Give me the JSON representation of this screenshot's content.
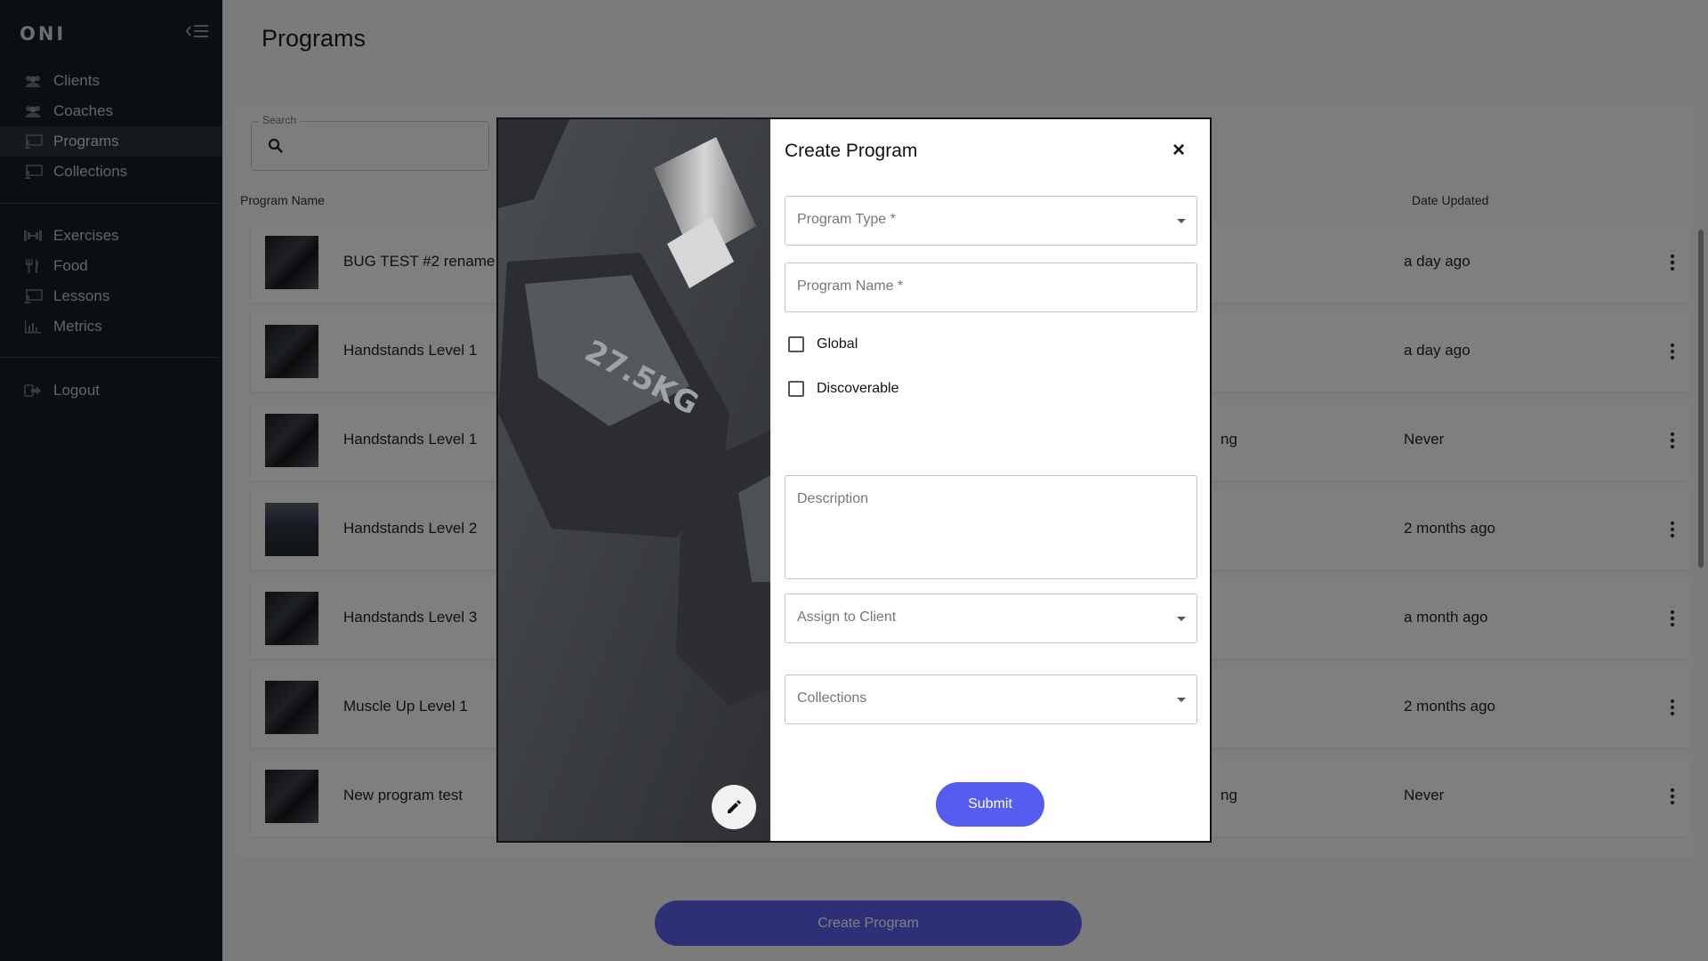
{
  "sidebar": {
    "logo": "ONI",
    "items": [
      {
        "label": "Clients",
        "icon": "users-icon"
      },
      {
        "label": "Coaches",
        "icon": "users-icon"
      },
      {
        "label": "Programs",
        "icon": "screen-icon",
        "active": true
      },
      {
        "label": "Collections",
        "icon": "screen-icon"
      },
      {
        "label": "Exercises",
        "icon": "dumbbell-icon"
      },
      {
        "label": "Food",
        "icon": "utensils-icon"
      },
      {
        "label": "Lessons",
        "icon": "screen-icon"
      },
      {
        "label": "Metrics",
        "icon": "bar-chart-icon"
      },
      {
        "label": "Logout",
        "icon": "logout-icon"
      }
    ]
  },
  "page": {
    "title": "Programs",
    "search_label": "Search",
    "columns": {
      "name": "Program Name",
      "date": "Date Updated"
    },
    "rows": [
      {
        "name": "BUG TEST #2 rename",
        "mid": "",
        "date": "a day ago"
      },
      {
        "name": "Handstands Level 1",
        "mid": "",
        "date": "a day ago"
      },
      {
        "name": "Handstands Level 1",
        "mid": "ng",
        "date": "Never"
      },
      {
        "name": "Handstands Level 2",
        "mid": "",
        "date": "2 months ago"
      },
      {
        "name": "Handstands Level 3",
        "mid": "",
        "date": "a month ago"
      },
      {
        "name": "Muscle Up Level 1",
        "mid": "",
        "date": "2 months ago"
      },
      {
        "name": "New program test",
        "mid": "ng",
        "date": "Never"
      }
    ],
    "create_button": "Create Program"
  },
  "modal": {
    "title": "Create Program",
    "close": "×",
    "program_type": "Program Type *",
    "program_name": "Program Name *",
    "global": "Global",
    "discoverable": "Discoverable",
    "description": "Description",
    "assign_client": "Assign to Client",
    "collections": "Collections",
    "submit": "Submit",
    "image_text": "27.5KG"
  },
  "colors": {
    "accent": "#555cf0",
    "sidebar": "#171c25"
  }
}
